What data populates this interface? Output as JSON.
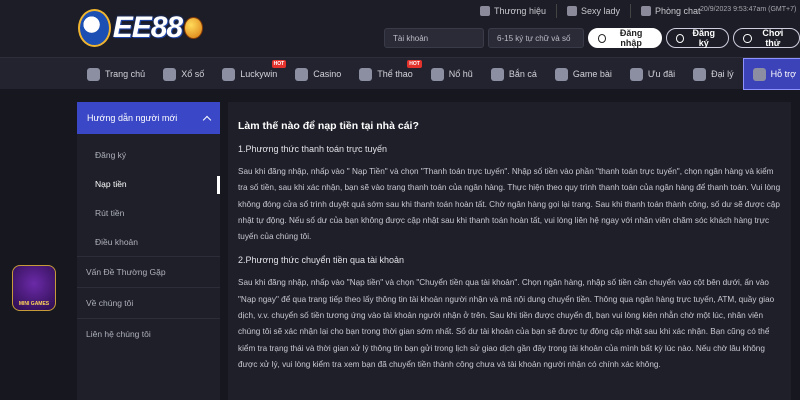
{
  "brand": {
    "logo_text": "EE88"
  },
  "topbar": {
    "links": [
      {
        "label": "Thương hiệu",
        "icon": "brand-icon"
      },
      {
        "label": "Sexy lady",
        "icon": "lady-icon"
      },
      {
        "label": "Phòng chat",
        "icon": "chat-icon"
      }
    ],
    "datetime": "20/9/2023 9:53:47am (GMT+7)"
  },
  "login": {
    "username_placeholder": "Tài khoản",
    "password_placeholder": "6-15 ký tự chữ và số",
    "login_label": "Đăng nhập",
    "register_label": "Đăng ký",
    "trial_label": "Chơi thử"
  },
  "nav": {
    "items": [
      {
        "label": "Trang chủ",
        "icon": "home-icon",
        "hot": ""
      },
      {
        "label": "Xổ số",
        "icon": "lottery-icon",
        "hot": ""
      },
      {
        "label": "Luckywin",
        "icon": "luckywin-icon",
        "hot": "HOT"
      },
      {
        "label": "Casino",
        "icon": "casino-icon",
        "hot": ""
      },
      {
        "label": "Thể thao",
        "icon": "sports-icon",
        "hot": "HOT"
      },
      {
        "label": "Nổ hũ",
        "icon": "slot-icon",
        "hot": ""
      },
      {
        "label": "Bắn cá",
        "icon": "fish-icon",
        "hot": ""
      },
      {
        "label": "Game bài",
        "icon": "cards-icon",
        "hot": ""
      },
      {
        "label": "Ưu đãi",
        "icon": "gift-icon",
        "hot": ""
      },
      {
        "label": "Đại lý",
        "icon": "agent-icon",
        "hot": ""
      },
      {
        "label": "Hỗ trợ",
        "icon": "support-icon",
        "hot": ""
      }
    ],
    "active_index": 10
  },
  "sidebar": {
    "group_title": "Hướng dẫn người mới",
    "items": [
      "Đăng ký",
      "Nạp tiền",
      "Rút tiền",
      "Điều khoản"
    ],
    "active_item": "Nạp tiền",
    "groups": [
      "Vấn Đề Thường Gặp",
      "Về chúng tôi",
      "Liên hệ chúng tôi"
    ]
  },
  "float_badge": {
    "text": "MINI GAMES"
  },
  "article": {
    "title": "Làm thế nào để nạp tiền tại nhà cái?",
    "section1_title": "1.Phương thức thanh toán trực tuyến",
    "section1_body": "Sau khi đăng nhập, nhấp vào \" Nạp Tiền\" và chọn \"Thanh toán trực tuyến\". Nhập số tiền vào phần \"thanh toán trực tuyến\", chọn ngân hàng và kiểm tra số tiền, sau khi xác nhận, bạn sẽ vào trang thanh toán của ngân hàng. Thực hiện theo quy trình thanh toán của ngân hàng để thanh toán. Vui lòng không đóng cửa sổ trình duyệt quá sớm sau khi thanh toán hoàn tất. Chờ ngân hàng gọi lại trang. Sau khi thanh toán thành công, số dư sẽ được cập nhật tự động. Nếu số dư của bạn không được cập nhật sau khi thanh toán hoàn tất, vui lòng liên hệ ngay với nhân viên chăm sóc khách hàng trực tuyến của chúng tôi.",
    "section2_title": "2.Phương thức chuyển tiền qua tài khoản",
    "section2_body": "Sau khi đăng nhập, nhấp vào \"Nạp tiền\" và chọn \"Chuyển tiền qua tài khoản\". Chọn ngân hàng, nhập số tiền cần chuyển vào cột bên dưới, ấn vào \"Nạp ngay\" để qua trang tiếp theo lấy thông tin tài khoản người nhận và mã nội dung chuyển tiền. Thông qua ngân hàng trực tuyến, ATM, quầy giao dịch, v.v. chuyển số tiền tương ứng vào tài khoản người nhận ở trên. Sau khi tiền được chuyển đi, bạn vui lòng kiên nhẫn chờ một lúc, nhân viên chúng tôi sẽ xác nhận lại cho bạn trong thời gian sớm nhất. Số dư tài khoản của bạn sẽ được tự động cập nhật sau khi xác nhận. Bạn cũng có thể kiểm tra trạng thái và thời gian xử lý thông tin bạn gửi trong lịch sử giao dịch gần đây trong tài khoản của mình bất kỳ lúc nào. Nếu chờ lâu không được xử lý, vui lòng kiểm tra xem bạn đã chuyển tiền thành công chưa và tài khoản người nhận có chính xác không."
  }
}
